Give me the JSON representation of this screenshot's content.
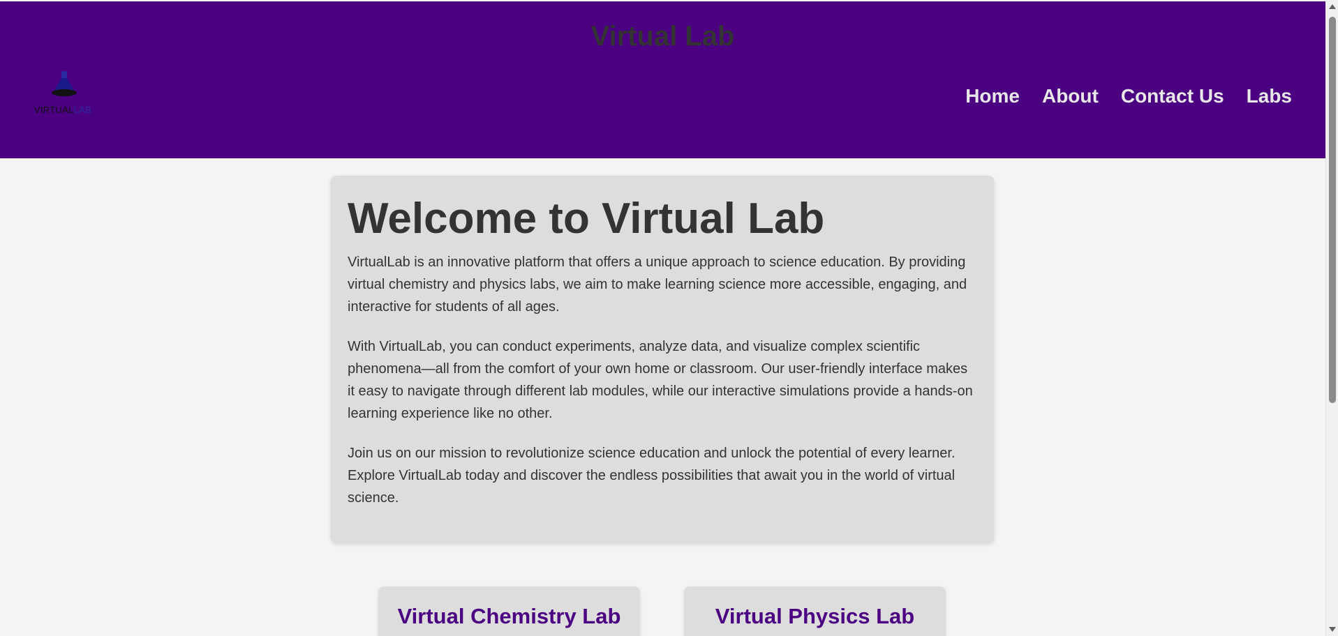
{
  "header": {
    "title": "Virtual Lab",
    "logo": {
      "icon": "flask-icon",
      "text_main": "VIRTUAL",
      "text_accent": "LAB"
    },
    "nav": [
      {
        "label": "Home"
      },
      {
        "label": "About"
      },
      {
        "label": "Contact Us"
      },
      {
        "label": "Labs"
      }
    ]
  },
  "welcome": {
    "heading": "Welcome to Virtual Lab",
    "paragraphs": [
      "VirtualLab is an innovative platform that offers a unique approach to science education. By providing virtual chemistry and physics labs, we aim to make learning science more accessible, engaging, and interactive for students of all ages.",
      "With VirtualLab, you can conduct experiments, analyze data, and visualize complex scientific phenomena—all from the comfort of your own home or classroom. Our user-friendly interface makes it easy to navigate through different lab modules, while our interactive simulations provide a hands-on learning experience like no other.",
      "Join us on our mission to revolutionize science education and unlock the potential of every learner. Explore VirtualLab today and discover the endless possibilities that await you in the world of virtual science."
    ]
  },
  "labs": [
    {
      "title": "Virtual Chemistry Lab"
    },
    {
      "title": "Virtual Physics Lab"
    }
  ],
  "colors": {
    "header_bg": "#4b0082",
    "page_bg": "#f4f4f4",
    "card_bg": "#dddddd",
    "lab_title": "#4b0082",
    "nav_text": "#e8e8e8",
    "body_text": "#333333"
  }
}
